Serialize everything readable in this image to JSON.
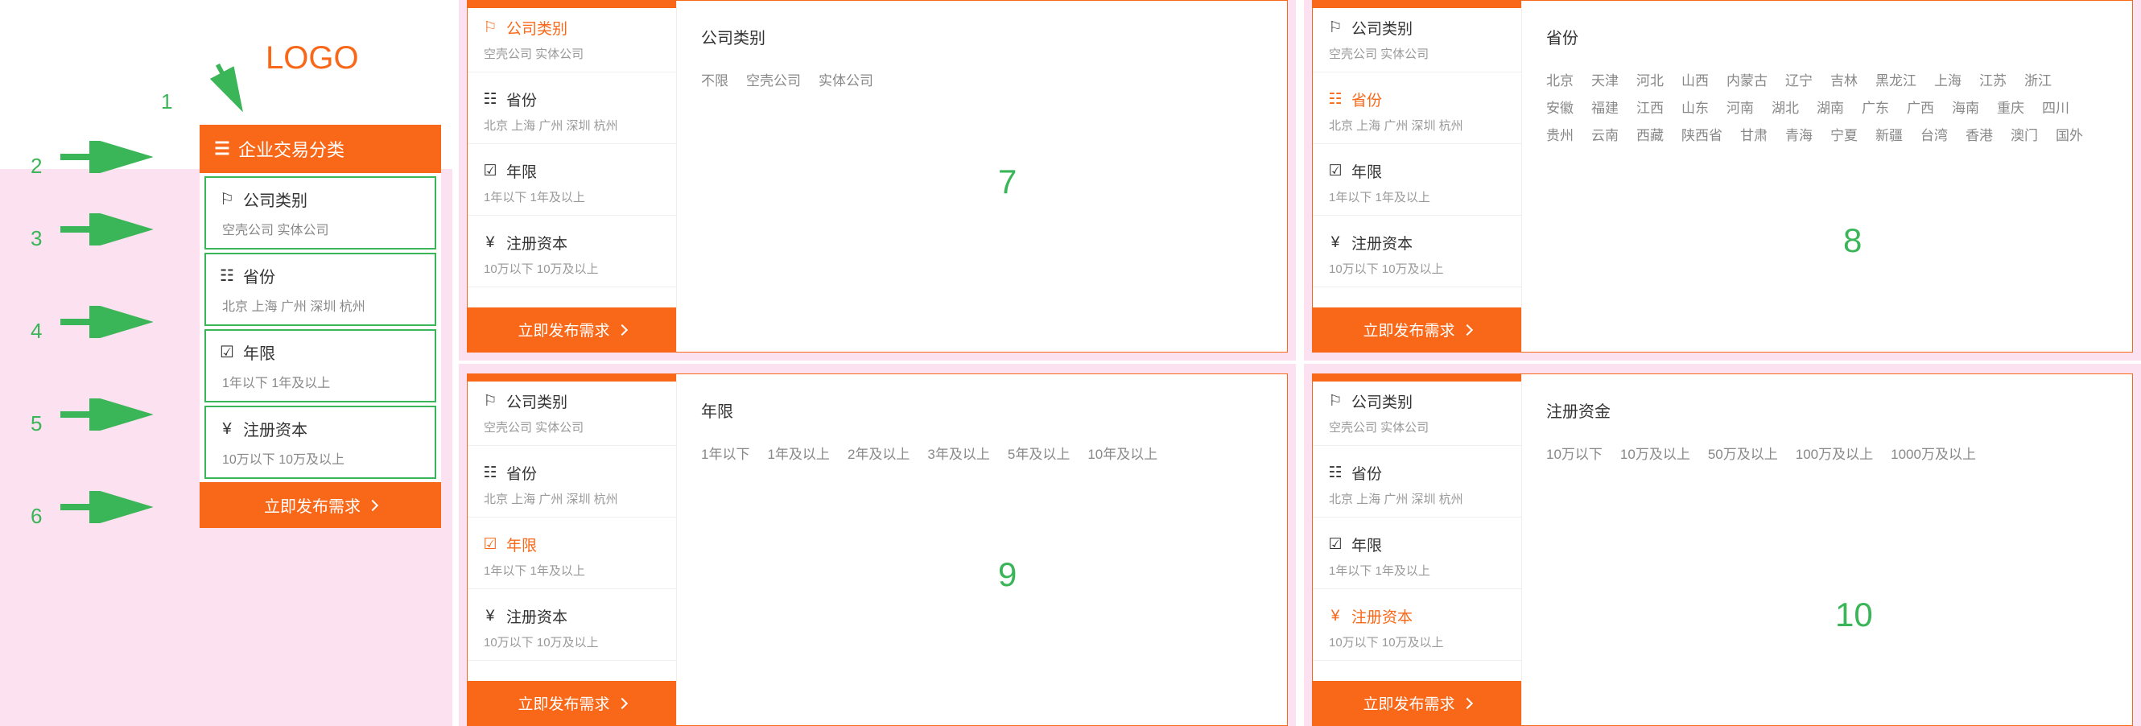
{
  "logo": "LOGO",
  "annotations": {
    "n1": "1",
    "n2": "2",
    "n3": "3",
    "n4": "4",
    "n5": "5",
    "n6": "6",
    "n7": "7",
    "n8": "8",
    "n9": "9",
    "n10": "10"
  },
  "sidebar": {
    "header": "企业交易分类",
    "items": [
      {
        "title": "公司类别",
        "tags": "空壳公司  实体公司"
      },
      {
        "title": "省份",
        "tags": "北京  上海  广州  深圳  杭州"
      },
      {
        "title": "年限",
        "tags": "1年以下  1年及以上"
      },
      {
        "title": "注册资本",
        "tags": "10万以下  10万及以上"
      }
    ],
    "button": "立即发布需求"
  },
  "panels": {
    "p7": {
      "active_index": 0,
      "content_title": "公司类别",
      "content_tags": [
        "不限",
        "空壳公司",
        "实体公司"
      ]
    },
    "p8": {
      "active_index": 1,
      "content_title": "省份",
      "content_tags": [
        "北京",
        "天津",
        "河北",
        "山西",
        "内蒙古",
        "辽宁",
        "吉林",
        "黑龙江",
        "上海",
        "江苏",
        "浙江",
        "安徽",
        "福建",
        "江西",
        "山东",
        "河南",
        "湖北",
        "湖南",
        "广东",
        "广西",
        "海南",
        "重庆",
        "四川",
        "贵州",
        "云南",
        "西藏",
        "陕西省",
        "甘肃",
        "青海",
        "宁夏",
        "新疆",
        "台湾",
        "香港",
        "澳门",
        "国外"
      ]
    },
    "p9": {
      "active_index": 2,
      "content_title": "年限",
      "content_tags": [
        "1年以下",
        "1年及以上",
        "2年及以上",
        "3年及以上",
        "5年及以上",
        "10年及以上"
      ]
    },
    "p10": {
      "active_index": 3,
      "content_title": "注册资金",
      "content_tags": [
        "10万以下",
        "10万及以上",
        "50万及以上",
        "100万及以上",
        "1000万及以上"
      ]
    }
  },
  "icons": {
    "list": "☰",
    "category": "⚐",
    "province": "☷",
    "year": "☑",
    "capital": "¥"
  }
}
